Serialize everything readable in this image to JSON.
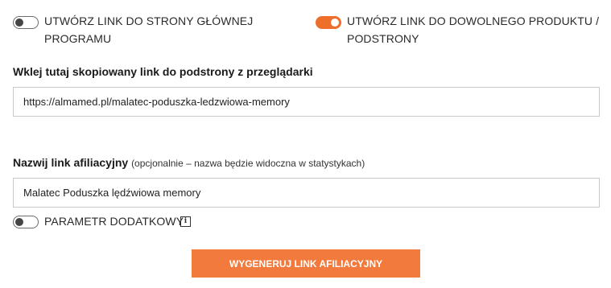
{
  "options": {
    "home_link": {
      "label": "UTWÓRZ LINK DO STRONY GŁÓWNEJ PROGRAMU",
      "enabled": false
    },
    "product_link": {
      "label": "UTWÓRZ LINK DO DOWOLNEGO PRODUKTU / PODSTRONY",
      "enabled": true
    },
    "extra_param": {
      "label": "PARAMETR DODATKOWY",
      "enabled": false,
      "info_glyph": "i"
    }
  },
  "url_field": {
    "label": "Wklej tutaj skopiowany link do podstrony z przeglądarki",
    "value": "https://almamed.pl/malatec-poduszka-ledzwiowa-memory"
  },
  "name_field": {
    "label": "Nazwij link afiliacyjny",
    "hint": "(opcjonalnie – nazwa będzie widoczna w statystykach)",
    "value": "Malatec Poduszka lędźwiowa memory"
  },
  "generate_button": {
    "label": "WYGENERUJ LINK AFILIACYJNY"
  },
  "colors": {
    "accent": "#f37a3d",
    "toggle_on": "#ee6e2c",
    "toggle_off_border": "#6b6b6b",
    "input_border": "#c9c9c9"
  }
}
